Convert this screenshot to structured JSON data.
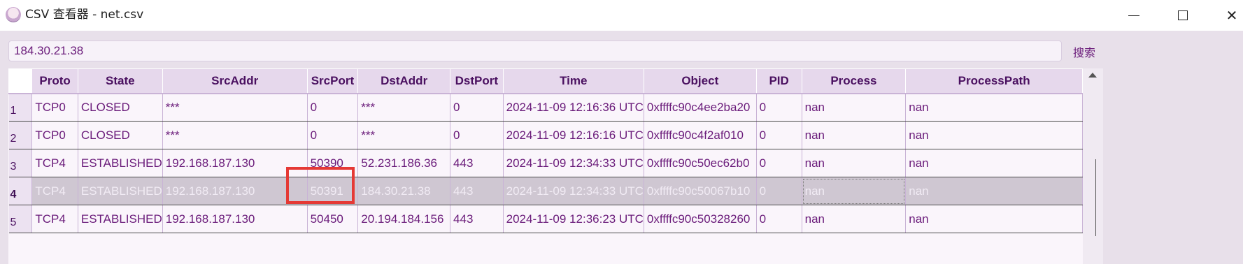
{
  "window": {
    "title": "CSV 查看器 - net.csv",
    "minimize_label": "—",
    "maximize_label": "☐",
    "close_label": "✕"
  },
  "search": {
    "value": "184.30.21.38",
    "button_label": "搜索"
  },
  "table": {
    "columns": [
      "Proto",
      "State",
      "SrcAddr",
      "SrcPort",
      "DstAddr",
      "DstPort",
      "Time",
      "Object",
      "PID",
      "Process",
      "ProcessPath"
    ],
    "rows": [
      {
        "num": "1",
        "cells": [
          "TCP0",
          "CLOSED",
          "***",
          "0",
          "***",
          "0",
          "2024-11-09 12:16:36 UTC",
          "0xffffc90c4ee2ba20",
          "0",
          "nan",
          "nan"
        ]
      },
      {
        "num": "2",
        "cells": [
          "TCP0",
          "CLOSED",
          "***",
          "0",
          "***",
          "0",
          "2024-11-09 12:16:16 UTC",
          "0xffffc90c4f2af010",
          "0",
          "nan",
          "nan"
        ]
      },
      {
        "num": "3",
        "cells": [
          "TCP4",
          "ESTABLISHED",
          "192.168.187.130",
          "50390",
          "52.231.186.36",
          "443",
          "2024-11-09 12:34:33 UTC",
          "0xffffc90c50ec62b0",
          "0",
          "nan",
          "nan"
        ]
      },
      {
        "num": "4",
        "cells": [
          "TCP4",
          "ESTABLISHED",
          "192.168.187.130",
          "50391",
          "184.30.21.38",
          "443",
          "2024-11-09 12:34:33 UTC",
          "0xffffc90c50067b10",
          "0",
          "nan",
          "nan"
        ]
      },
      {
        "num": "5",
        "cells": [
          "TCP4",
          "ESTABLISHED",
          "192.168.187.130",
          "50450",
          "20.194.184.156",
          "443",
          "2024-11-09 12:36:23 UTC",
          "0xffffc90c50328260",
          "0",
          "nan",
          "nan"
        ]
      }
    ],
    "selected_row": "4"
  },
  "colors": {
    "text": "#6a1b7a",
    "header_bg": "#e6d8ec",
    "selected_bg": "#cfc7d2",
    "highlight": "#e53935"
  }
}
